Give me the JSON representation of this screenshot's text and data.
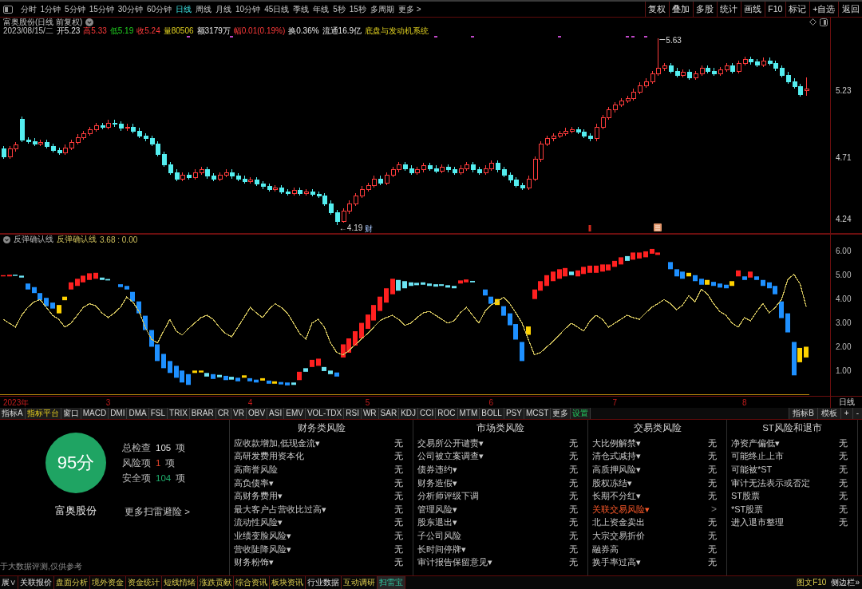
{
  "toolbar": {
    "periods": [
      {
        "label": "分时",
        "selected": false
      },
      {
        "label": "1分钟",
        "selected": false
      },
      {
        "label": "5分钟",
        "selected": false
      },
      {
        "label": "15分钟",
        "selected": false
      },
      {
        "label": "30分钟",
        "selected": false
      },
      {
        "label": "60分钟",
        "selected": false
      },
      {
        "label": "日线",
        "selected": true
      },
      {
        "label": "周线",
        "selected": false
      },
      {
        "label": "月线",
        "selected": false
      },
      {
        "label": "10分钟",
        "selected": false
      },
      {
        "label": "45日线",
        "selected": false
      },
      {
        "label": "季线",
        "selected": false
      },
      {
        "label": "年线",
        "selected": false
      },
      {
        "label": "5秒",
        "selected": false
      },
      {
        "label": "15秒",
        "selected": false
      },
      {
        "label": "多周期",
        "selected": false
      },
      {
        "label": "更多 >",
        "selected": false
      }
    ],
    "actions": [
      "复权",
      "叠加",
      "多股",
      "统计",
      "画线",
      "F10",
      "标记",
      "+自选",
      "返回"
    ]
  },
  "chart": {
    "title": "富奥股份(日线 前复权)",
    "quote": [
      {
        "text": "2023/08/15/二",
        "kind": "date"
      },
      {
        "text": "开5.23",
        "kind": "plain"
      },
      {
        "text": "高5.33",
        "kind": "up"
      },
      {
        "text": "低5.19",
        "kind": "down"
      },
      {
        "text": "收5.24",
        "kind": "up"
      },
      {
        "text": "量80506",
        "kind": "volume"
      },
      {
        "text": "额3179万",
        "kind": "plain"
      },
      {
        "text": "幅0.01(0.19%)",
        "kind": "up"
      },
      {
        "text": "换0.36%",
        "kind": "plain"
      },
      {
        "text": "流通16.9亿",
        "kind": "plain"
      },
      {
        "text": "底盘与发动机系统",
        "kind": "sector"
      }
    ],
    "indicator": {
      "name": "反弹确认线",
      "reading": "3.68 : 0.00"
    },
    "year_label": "2023年",
    "chart_data": [
      {
        "type": "candlestick",
        "ylim": [
          4.13,
          5.79
        ],
        "yticks": [
          4.24,
          4.71,
          5.23
        ],
        "tick_labels": "y",
        "annotations": [
          "5.63",
          "←4.19",
          "财"
        ],
        "ohlc": [
          [
            4.78,
            4.8,
            4.7,
            4.72
          ],
          [
            4.72,
            4.8,
            4.7,
            4.78
          ],
          [
            4.78,
            4.83,
            4.76,
            4.81
          ],
          [
            5.01,
            5.03,
            4.83,
            4.85
          ],
          [
            4.85,
            4.87,
            4.82,
            4.84
          ],
          [
            4.84,
            4.86,
            4.8,
            4.82
          ],
          [
            4.82,
            4.85,
            4.8,
            4.83
          ],
          [
            4.83,
            4.85,
            4.78,
            4.8
          ],
          [
            4.8,
            4.82,
            4.75,
            4.77
          ],
          [
            4.77,
            4.79,
            4.73,
            4.75
          ],
          [
            4.75,
            4.81,
            4.73,
            4.79
          ],
          [
            4.79,
            4.85,
            4.77,
            4.83
          ],
          [
            4.83,
            4.89,
            4.81,
            4.87
          ],
          [
            4.87,
            4.92,
            4.85,
            4.9
          ],
          [
            4.9,
            4.95,
            4.88,
            4.93
          ],
          [
            4.93,
            4.98,
            4.91,
            4.96
          ],
          [
            4.96,
            4.98,
            4.93,
            4.95
          ],
          [
            4.95,
            5.0,
            4.93,
            4.98
          ],
          [
            4.98,
            5.0,
            4.95,
            4.97
          ],
          [
            4.97,
            4.99,
            4.92,
            4.94
          ],
          [
            4.94,
            4.97,
            4.92,
            4.95
          ],
          [
            4.95,
            4.97,
            4.9,
            4.92
          ],
          [
            4.92,
            4.94,
            4.86,
            4.88
          ],
          [
            4.88,
            4.9,
            4.84,
            4.86
          ],
          [
            4.86,
            4.88,
            4.8,
            4.82
          ],
          [
            4.82,
            4.84,
            4.72,
            4.74
          ],
          [
            4.74,
            4.76,
            4.64,
            4.66
          ],
          [
            4.66,
            4.68,
            4.58,
            4.6
          ],
          [
            4.6,
            4.62,
            4.53,
            4.55
          ],
          [
            4.55,
            4.6,
            4.53,
            4.58
          ],
          [
            4.58,
            4.6,
            4.54,
            4.56
          ],
          [
            4.56,
            4.62,
            4.54,
            4.6
          ],
          [
            4.6,
            4.64,
            4.58,
            4.62
          ],
          [
            4.62,
            4.64,
            4.55,
            4.57
          ],
          [
            4.57,
            4.59,
            4.53,
            4.55
          ],
          [
            4.55,
            4.6,
            4.53,
            4.58
          ],
          [
            4.58,
            4.62,
            4.56,
            4.6
          ],
          [
            4.6,
            4.62,
            4.55,
            4.57
          ],
          [
            4.57,
            4.59,
            4.53,
            4.55
          ],
          [
            4.55,
            4.57,
            4.51,
            4.53
          ],
          [
            4.53,
            4.56,
            4.51,
            4.54
          ],
          [
            4.54,
            4.56,
            4.49,
            4.51
          ],
          [
            4.51,
            4.53,
            4.47,
            4.49
          ],
          [
            4.49,
            4.51,
            4.45,
            4.47
          ],
          [
            4.47,
            4.5,
            4.45,
            4.48
          ],
          [
            4.48,
            4.5,
            4.43,
            4.45
          ],
          [
            4.45,
            4.47,
            4.42,
            4.44
          ],
          [
            4.44,
            4.48,
            4.42,
            4.46
          ],
          [
            4.46,
            4.48,
            4.42,
            4.44
          ],
          [
            4.44,
            4.47,
            4.42,
            4.45
          ],
          [
            4.45,
            4.47,
            4.41,
            4.43
          ],
          [
            4.43,
            4.45,
            4.4,
            4.42
          ],
          [
            4.42,
            4.44,
            4.34,
            4.36
          ],
          [
            4.36,
            4.38,
            4.27,
            4.29
          ],
          [
            4.29,
            4.31,
            4.19,
            4.22
          ],
          [
            4.22,
            4.32,
            4.21,
            4.3
          ],
          [
            4.3,
            4.38,
            4.28,
            4.36
          ],
          [
            4.36,
            4.44,
            4.34,
            4.42
          ],
          [
            4.42,
            4.49,
            4.4,
            4.47
          ],
          [
            4.47,
            4.52,
            4.45,
            4.5
          ],
          [
            4.5,
            4.57,
            4.48,
            4.55
          ],
          [
            4.55,
            4.57,
            4.5,
            4.52
          ],
          [
            4.52,
            4.6,
            4.5,
            4.58
          ],
          [
            4.58,
            4.64,
            4.56,
            4.62
          ],
          [
            4.62,
            4.68,
            4.6,
            4.66
          ],
          [
            4.66,
            4.68,
            4.61,
            4.63
          ],
          [
            4.63,
            4.65,
            4.58,
            4.6
          ],
          [
            4.6,
            4.64,
            4.58,
            4.62
          ],
          [
            4.62,
            4.67,
            4.6,
            4.65
          ],
          [
            4.65,
            4.67,
            4.61,
            4.63
          ],
          [
            4.63,
            4.65,
            4.59,
            4.61
          ],
          [
            4.61,
            4.66,
            4.59,
            4.64
          ],
          [
            4.64,
            4.66,
            4.6,
            4.62
          ],
          [
            4.62,
            4.64,
            4.58,
            4.6
          ],
          [
            4.6,
            4.65,
            4.58,
            4.63
          ],
          [
            4.63,
            4.68,
            4.61,
            4.66
          ],
          [
            4.66,
            4.68,
            4.6,
            4.62
          ],
          [
            4.62,
            4.64,
            4.58,
            4.6
          ],
          [
            4.6,
            4.65,
            4.58,
            4.63
          ],
          [
            4.63,
            4.69,
            4.61,
            4.67
          ],
          [
            4.67,
            4.69,
            4.6,
            4.62
          ],
          [
            4.62,
            4.64,
            4.56,
            4.58
          ],
          [
            4.58,
            4.6,
            4.52,
            4.54
          ],
          [
            4.54,
            4.56,
            4.48,
            4.5
          ],
          [
            4.5,
            4.52,
            4.46,
            4.48
          ],
          [
            4.48,
            4.57,
            4.46,
            4.55
          ],
          [
            4.55,
            4.72,
            4.53,
            4.7
          ],
          [
            4.7,
            4.84,
            4.68,
            4.82
          ],
          [
            4.82,
            4.88,
            4.8,
            4.86
          ],
          [
            4.86,
            4.9,
            4.84,
            4.88
          ],
          [
            4.88,
            4.92,
            4.86,
            4.9
          ],
          [
            4.9,
            4.94,
            4.88,
            4.92
          ],
          [
            4.92,
            4.95,
            4.9,
            4.93
          ],
          [
            4.93,
            4.95,
            4.89,
            4.91
          ],
          [
            4.91,
            4.93,
            4.86,
            4.88
          ],
          [
            4.88,
            4.9,
            4.84,
            4.86
          ],
          [
            4.86,
            4.97,
            4.84,
            4.95
          ],
          [
            4.95,
            5.04,
            4.93,
            5.02
          ],
          [
            5.02,
            5.1,
            5.0,
            5.08
          ],
          [
            5.08,
            5.14,
            5.06,
            5.12
          ],
          [
            5.12,
            5.17,
            5.1,
            5.15
          ],
          [
            5.15,
            5.19,
            5.13,
            5.17
          ],
          [
            5.17,
            5.24,
            5.15,
            5.22
          ],
          [
            5.22,
            5.29,
            5.2,
            5.27
          ],
          [
            5.27,
            5.32,
            5.25,
            5.3
          ],
          [
            5.3,
            5.38,
            5.28,
            5.36
          ],
          [
            5.36,
            5.63,
            5.34,
            5.4
          ],
          [
            5.4,
            5.44,
            5.38,
            5.42
          ],
          [
            5.42,
            5.44,
            5.36,
            5.38
          ],
          [
            5.38,
            5.4,
            5.33,
            5.35
          ],
          [
            5.35,
            5.39,
            5.33,
            5.37
          ],
          [
            5.37,
            5.39,
            5.31,
            5.33
          ],
          [
            5.33,
            5.38,
            5.31,
            5.36
          ],
          [
            5.36,
            5.42,
            5.34,
            5.4
          ],
          [
            5.4,
            5.42,
            5.36,
            5.38
          ],
          [
            5.38,
            5.4,
            5.34,
            5.36
          ],
          [
            5.36,
            5.41,
            5.34,
            5.39
          ],
          [
            5.39,
            5.44,
            5.37,
            5.42
          ],
          [
            5.42,
            5.44,
            5.36,
            5.38
          ],
          [
            5.38,
            5.46,
            5.36,
            5.44
          ],
          [
            5.44,
            5.49,
            5.42,
            5.47
          ],
          [
            5.47,
            5.49,
            5.43,
            5.45
          ],
          [
            5.45,
            5.47,
            5.41,
            5.43
          ],
          [
            5.43,
            5.48,
            5.41,
            5.46
          ],
          [
            5.46,
            5.48,
            5.42,
            5.44
          ],
          [
            5.44,
            5.46,
            5.38,
            5.4
          ],
          [
            5.4,
            5.42,
            5.33,
            5.35
          ],
          [
            5.35,
            5.37,
            5.28,
            5.3
          ],
          [
            5.3,
            5.32,
            5.24,
            5.26
          ],
          [
            5.26,
            5.28,
            5.18,
            5.2
          ],
          [
            5.23,
            5.33,
            5.19,
            5.24
          ]
        ]
      },
      {
        "type": "bar",
        "ylim": [
          -0.06,
          6.7
        ],
        "yticks": [
          {
            "value": 1,
            "label": "1.00"
          },
          {
            "value": 2,
            "label": "2.00"
          },
          {
            "value": 3,
            "label": "3.00"
          },
          {
            "value": 4,
            "label": "4.00"
          },
          {
            "value": 5,
            "label": "5.00"
          },
          {
            "value": 6,
            "label": "6.00"
          }
        ],
        "ref_lines": [
          {
            "axis": "y",
            "value": 0,
            "color": "#b8860b"
          }
        ],
        "categories": [
          null,
          null,
          null,
          null,
          null,
          null,
          null,
          null,
          null,
          null,
          null,
          null,
          null,
          null,
          null,
          null,
          null,
          "3",
          null,
          null,
          null,
          null,
          null,
          null,
          null,
          null,
          null,
          null,
          null,
          null,
          null,
          null,
          null,
          null,
          null,
          null,
          null,
          null,
          null,
          null,
          "4",
          null,
          null,
          null,
          null,
          null,
          null,
          null,
          null,
          null,
          null,
          null,
          null,
          null,
          null,
          null,
          null,
          null,
          null,
          "5",
          null,
          null,
          null,
          null,
          null,
          null,
          null,
          null,
          null,
          null,
          null,
          null,
          null,
          null,
          null,
          null,
          null,
          null,
          null,
          "6",
          null,
          null,
          null,
          null,
          null,
          null,
          null,
          null,
          null,
          null,
          null,
          null,
          null,
          null,
          null,
          null,
          null,
          null,
          null,
          "7",
          null,
          null,
          null,
          null,
          null,
          null,
          null,
          null,
          null,
          null,
          null,
          null,
          null,
          null,
          null,
          null,
          null,
          null,
          null,
          null,
          "8",
          null,
          null,
          null,
          null,
          null,
          null,
          null,
          null,
          null,
          null
        ],
        "series": [
          {
            "type": "bar",
            "base": [
              4.95,
              4.95,
              4.97,
              4.9,
              4.4,
              4.25,
              3.95,
              3.7,
              3.6,
              3.4,
              3.95,
              4.4,
              4.55,
              4.7,
              4.8,
              4.85,
              4.8,
              4.78,
              null,
              4.5,
              4.4,
              3.9,
              3.4,
              2.7,
              2.0,
              1.4,
              1.1,
              0.9,
              0.7,
              0.5,
              0.4,
              0.9,
              0.92,
              0.75,
              0.65,
              0.72,
              0.6,
              0.62,
              0.55,
              0.7,
              0.55,
              0.5,
              0.58,
              0.45,
              0.45,
              0.42,
              0.38,
              0.4,
              0.6,
              0.95,
              1.15,
              1.2,
              0.98,
              0.85,
              0.75,
              1.55,
              1.75,
              2.05,
              2.35,
              2.75,
              3.1,
              3.5,
              3.85,
              4.2,
              4.35,
              4.45,
              4.55,
              4.58,
              4.6,
              4.55,
              4.52,
              4.55,
              4.48,
              4.45,
              4.65,
              4.7,
              4.7,
              null,
              4.15,
              3.8,
              3.75,
              3.3,
              2.9,
              2.3,
              1.4,
              2.5,
              4.0,
              4.35,
              4.55,
              4.75,
              4.85,
              4.95,
              5.0,
              4.95,
              5.05,
              5.1,
              5.1,
              5.15,
              5.2,
              5.35,
              5.45,
              5.6,
              5.65,
              5.7,
              5.75,
              5.9,
              5.85,
              null,
              5.25,
              4.95,
              4.85,
              4.95,
              4.75,
              4.6,
              4.6,
              4.55,
              4.48,
              4.45,
              4.55,
              4.95,
              4.8,
              4.9,
              4.8,
              4.55,
              4.45,
              4.2,
              3.2,
              2.6,
              0.8,
              1.35,
              1.55
            ],
            "values": [
              0.05,
              0.07,
              0.05,
              0.08,
              0.25,
              0.25,
              0.3,
              0.35,
              0.25,
              0.35,
              0.15,
              0.3,
              0.3,
              0.28,
              0.28,
              0.25,
              0.1,
              0.06,
              null,
              0.12,
              0.15,
              0.4,
              0.5,
              0.6,
              0.7,
              0.7,
              0.6,
              0.5,
              0.5,
              0.5,
              0.45,
              0.1,
              0.08,
              0.15,
              0.2,
              0.1,
              0.18,
              0.12,
              0.15,
              0.1,
              0.13,
              0.12,
              0.1,
              0.13,
              0.1,
              0.1,
              0.12,
              0.1,
              0.35,
              0.15,
              0.3,
              0.3,
              0.17,
              0.15,
              0.17,
              0.55,
              0.6,
              0.6,
              0.65,
              0.6,
              0.65,
              0.6,
              0.6,
              0.65,
              0.45,
              0.3,
              0.15,
              0.1,
              0.1,
              0.1,
              0.1,
              0.07,
              0.1,
              0.1,
              0.13,
              0.12,
              0.06,
              null,
              0.25,
              0.3,
              0.25,
              0.4,
              0.5,
              0.65,
              0.8,
              0.35,
              0.4,
              0.4,
              0.45,
              0.4,
              0.4,
              0.35,
              0.15,
              0.25,
              0.3,
              0.3,
              0.3,
              0.3,
              0.25,
              0.25,
              0.3,
              0.2,
              0.3,
              0.25,
              0.25,
              0.2,
              0.1,
              null,
              0.3,
              0.3,
              0.3,
              0.15,
              0.25,
              0.25,
              0.2,
              0.17,
              0.17,
              0.15,
              0.2,
              0.25,
              0.15,
              0.25,
              0.15,
              0.25,
              0.25,
              0.35,
              0.7,
              0.8,
              1.4,
              0.6,
              0.45
            ],
            "colors": [
              "#ff2020",
              "#ff2020",
              "#6ce4f4",
              "#6ce4f4",
              "#1e90ff",
              "#1e90ff",
              "#1e90ff",
              "#1e90ff",
              "#1e90ff",
              "#ffd200",
              "#ffd200",
              "#ff2020",
              "#ff2020",
              "#ff2020",
              "#ff2020",
              "#ff2020",
              "#6ce4f4",
              "#6ce4f4",
              null,
              "#1e90ff",
              "#1e90ff",
              "#1e90ff",
              "#1e90ff",
              "#1e90ff",
              "#1e90ff",
              "#1e90ff",
              "#1e90ff",
              "#1e90ff",
              "#1e90ff",
              "#1e90ff",
              "#1e90ff",
              "#ffd200",
              "#ffd200",
              "#6ce4f4",
              "#1e90ff",
              "#6ce4f4",
              "#1e90ff",
              "#6ce4f4",
              "#1e90ff",
              "#ffd200",
              "#1e90ff",
              "#1e90ff",
              "#ffd200",
              "#1e90ff",
              "#ffd200",
              "#1e90ff",
              "#1e90ff",
              "#6ce4f4",
              "#ff2020",
              "#6ce4f4",
              "#ff2020",
              "#ff2020",
              "#6ce4f4",
              "#6ce4f4",
              "#1e90ff",
              "#ff2020",
              "#ff2020",
              "#ff2020",
              "#ff2020",
              "#ff2020",
              "#ff2020",
              "#ff2020",
              "#ff2020",
              "#ff2020",
              "#6ce4f4",
              "#6ce4f4",
              "#6ce4f4",
              "#6ce4f4",
              "#6ce4f4",
              "#6ce4f4",
              "#6ce4f4",
              "#6ce4f4",
              "#6ce4f4",
              "#6ce4f4",
              "#ff2020",
              "#ff2020",
              "#6ce4f4",
              null,
              "#1e90ff",
              "#1e90ff",
              "#ffd200",
              "#1e90ff",
              "#1e90ff",
              "#1e90ff",
              "#1e90ff",
              "#ffd200",
              "#ff2020",
              "#ff2020",
              "#ff2020",
              "#ff2020",
              "#ff2020",
              "#ff2020",
              "#6ce4f4",
              "#ff2020",
              "#ff2020",
              "#ff2020",
              "#ff2020",
              "#ff2020",
              "#ff2020",
              "#ff2020",
              "#ff2020",
              "#6ce4f4",
              "#ff2020",
              "#ff2020",
              "#ff2020",
              "#ff2020",
              "#ff2020",
              null,
              "#1e90ff",
              "#1e90ff",
              "#1e90ff",
              "#ffd200",
              "#1e90ff",
              "#1e90ff",
              "#ffd200",
              "#1e90ff",
              "#1e90ff",
              "#1e90ff",
              "#ffd200",
              "#ff2020",
              "#1e90ff",
              "#ff2020",
              "#1e90ff",
              "#1e90ff",
              "#1e90ff",
              "#1e90ff",
              "#1e90ff",
              "#1e90ff",
              "#1e90ff",
              "#ffd200",
              "#ffd200"
            ]
          },
          {
            "type": "line",
            "name": "反弹确认线",
            "color": "#cfc05c",
            "values": [
              3.15,
              2.99,
              2.82,
              3.32,
              3.65,
              3.88,
              3.98,
              3.65,
              3.32,
              3.15,
              2.82,
              2.99,
              3.32,
              3.65,
              3.81,
              3.71,
              3.42,
              3.22,
              3.42,
              3.65,
              4.08,
              3.88,
              3.48,
              2.82,
              2.32,
              2.16,
              2.66,
              3.15,
              2.66,
              2.49,
              2.76,
              2.99,
              3.22,
              3.32,
              3.15,
              2.82,
              2.56,
              2.42,
              2.82,
              3.22,
              3.65,
              3.42,
              3.22,
              3.55,
              3.81,
              3.65,
              3.42,
              2.99,
              2.56,
              2.32,
              2.99,
              3.15,
              2.82,
              2.16,
              1.76,
              1.66,
              1.83,
              2.09,
              2.32,
              2.56,
              2.82,
              3.09,
              3.22,
              3.32,
              3.15,
              2.89,
              2.99,
              3.22,
              3.42,
              3.48,
              3.32,
              3.15,
              2.99,
              3.09,
              3.42,
              3.65,
              3.32,
              2.99,
              3.48,
              3.75,
              3.88,
              4.08,
              3.81,
              3.42,
              2.99,
              2.32,
              1.66,
              1.76,
              1.99,
              2.22,
              2.49,
              2.76,
              2.99,
              2.82,
              2.66,
              3.09,
              3.32,
              3.15,
              2.82,
              2.99,
              3.15,
              3.32,
              3.22,
              3.15,
              3.42,
              3.65,
              3.81,
              3.98,
              3.81,
              3.55,
              3.75,
              4.15,
              3.88,
              4.41,
              4.21,
              3.81,
              3.48,
              3.32,
              2.99,
              2.82,
              3.22,
              3.09,
              3.48,
              3.81,
              3.42,
              3.65,
              3.98,
              4.81,
              5.04,
              4.64,
              3.68
            ]
          }
        ]
      }
    ],
    "period_label": "日线"
  },
  "indicator_tabs": {
    "tabs": [
      {
        "label": "指标A",
        "kind": "tab"
      },
      {
        "label": "指标平台",
        "kind": "platform"
      },
      {
        "label": "窗口",
        "kind": "tab"
      },
      {
        "label": "MACD",
        "kind": "tab"
      },
      {
        "label": "DMI",
        "kind": "tab"
      },
      {
        "label": "DMA",
        "kind": "tab"
      },
      {
        "label": "FSL",
        "kind": "tab"
      },
      {
        "label": "TRIX",
        "kind": "tab"
      },
      {
        "label": "BRAR",
        "kind": "tab"
      },
      {
        "label": "CR",
        "kind": "tab"
      },
      {
        "label": "VR",
        "kind": "tab"
      },
      {
        "label": "OBV",
        "kind": "tab"
      },
      {
        "label": "ASI",
        "kind": "tab"
      },
      {
        "label": "EMV",
        "kind": "tab"
      },
      {
        "label": "VOL-TDX",
        "kind": "tab"
      },
      {
        "label": "RSI",
        "kind": "tab"
      },
      {
        "label": "WR",
        "kind": "tab"
      },
      {
        "label": "SAR",
        "kind": "tab"
      },
      {
        "label": "KDJ",
        "kind": "tab"
      },
      {
        "label": "CCI",
        "kind": "tab"
      },
      {
        "label": "ROC",
        "kind": "tab"
      },
      {
        "label": "MTM",
        "kind": "tab"
      },
      {
        "label": "BOLL",
        "kind": "tab"
      },
      {
        "label": "PSY",
        "kind": "tab"
      },
      {
        "label": "MCST",
        "kind": "tab"
      },
      {
        "label": "更多",
        "kind": "tab"
      },
      {
        "label": "设置",
        "kind": "settings"
      }
    ],
    "right": [
      "指标B",
      "模板",
      "+",
      "-"
    ]
  },
  "risk_scan": {
    "score": "95分",
    "stock": "富奥股份",
    "stats": [
      {
        "label": "总检查",
        "count": "105",
        "unit": "项",
        "kind": "total"
      },
      {
        "label": "风险项",
        "count": "1",
        "unit": "项",
        "kind": "risk"
      },
      {
        "label": "安全项",
        "count": "104",
        "unit": "项",
        "kind": "safe"
      }
    ],
    "more_link": "更多扫雷避险 >",
    "disclaimer": "于大数据评测,仅供参考",
    "columns": [
      {
        "title": "财务类风险",
        "items": [
          {
            "name": "应收款增加,低现金流▾",
            "value": "无",
            "flagged": false
          },
          {
            "name": "高研发费用资本化",
            "value": "无",
            "flagged": false
          },
          {
            "name": "高商誉风险",
            "value": "无",
            "flagged": false
          },
          {
            "name": "高负债率▾",
            "value": "无",
            "flagged": false
          },
          {
            "name": "高财务费用▾",
            "value": "无",
            "flagged": false
          },
          {
            "name": "最大客户占营收比过高▾",
            "value": "无",
            "flagged": false
          },
          {
            "name": "流动性风险▾",
            "value": "无",
            "flagged": false
          },
          {
            "name": "业绩变脸风险▾",
            "value": "无",
            "flagged": false
          },
          {
            "name": "营收陡降风险▾",
            "value": "无",
            "flagged": false
          },
          {
            "name": "财务粉饰▾",
            "value": "无",
            "flagged": false
          }
        ]
      },
      {
        "title": "市场类风险",
        "items": [
          {
            "name": "交易所公开谴责▾",
            "value": "无",
            "flagged": false
          },
          {
            "name": "公司被立案调查▾",
            "value": "无",
            "flagged": false
          },
          {
            "name": "债券违约▾",
            "value": "无",
            "flagged": false
          },
          {
            "name": "财务造假▾",
            "value": "无",
            "flagged": false
          },
          {
            "name": "分析师评级下调",
            "value": "无",
            "flagged": false
          },
          {
            "name": "管理风险▾",
            "value": "无",
            "flagged": false
          },
          {
            "name": "股东退出▾",
            "value": "无",
            "flagged": false
          },
          {
            "name": "子公司风险",
            "value": "无",
            "flagged": false
          },
          {
            "name": "长时间停牌▾",
            "value": "无",
            "flagged": false
          },
          {
            "name": "审计报告保留意见▾",
            "value": "无",
            "flagged": false
          }
        ]
      },
      {
        "title": "交易类风险",
        "items": [
          {
            "name": "大比例解禁▾",
            "value": "无",
            "flagged": false
          },
          {
            "name": "清仓式减持▾",
            "value": "无",
            "flagged": false
          },
          {
            "name": "高质押风险▾",
            "value": "无",
            "flagged": false
          },
          {
            "name": "股权冻结▾",
            "value": "无",
            "flagged": false
          },
          {
            "name": "长期不分红▾",
            "value": "无",
            "flagged": false
          },
          {
            "name": "关联交易风险▾",
            "value": ">",
            "flagged": true
          },
          {
            "name": "北上资金卖出",
            "value": "无",
            "flagged": false
          },
          {
            "name": "大宗交易折价",
            "value": "无",
            "flagged": false
          },
          {
            "name": "融券高",
            "value": "无",
            "flagged": false
          },
          {
            "name": "换手率过高▾",
            "value": "无",
            "flagged": false
          }
        ]
      },
      {
        "title": "ST风险和退市",
        "items": [
          {
            "name": "净资产偏低▾",
            "value": "无",
            "flagged": false
          },
          {
            "name": "可能终止上市",
            "value": "无",
            "flagged": false
          },
          {
            "name": "可能被*ST",
            "value": "无",
            "flagged": false
          },
          {
            "name": "审计无法表示或否定",
            "value": "无",
            "flagged": false
          },
          {
            "name": "ST股票",
            "value": "无",
            "flagged": false
          },
          {
            "name": "*ST股票",
            "value": "无",
            "flagged": false
          },
          {
            "name": "进入退市整理",
            "value": "无",
            "flagged": false
          }
        ]
      }
    ]
  },
  "bottom_bar": {
    "tabs": [
      {
        "label": "展∨",
        "kind": "plain",
        "selected": false
      },
      {
        "label": "关联报价",
        "kind": "plain",
        "selected": false
      },
      {
        "label": "盘面分析",
        "kind": "feature",
        "selected": false
      },
      {
        "label": "境外资金",
        "kind": "feature",
        "selected": false
      },
      {
        "label": "资金统计",
        "kind": "feature",
        "selected": false
      },
      {
        "label": "短线情绪",
        "kind": "feature",
        "selected": false
      },
      {
        "label": "涨跌贡献",
        "kind": "feature",
        "selected": false
      },
      {
        "label": "综合资讯",
        "kind": "feature",
        "selected": false
      },
      {
        "label": "板块资讯",
        "kind": "feature",
        "selected": false
      },
      {
        "label": "行业数据",
        "kind": "plain",
        "selected": false
      },
      {
        "label": "互动调研",
        "kind": "feature",
        "selected": false
      },
      {
        "label": "扫雷宝",
        "kind": "feature",
        "selected": true
      }
    ],
    "links": [
      {
        "label": "图文F10",
        "kind": "feature"
      },
      {
        "label": "侧边栏»",
        "kind": "plain"
      }
    ]
  }
}
